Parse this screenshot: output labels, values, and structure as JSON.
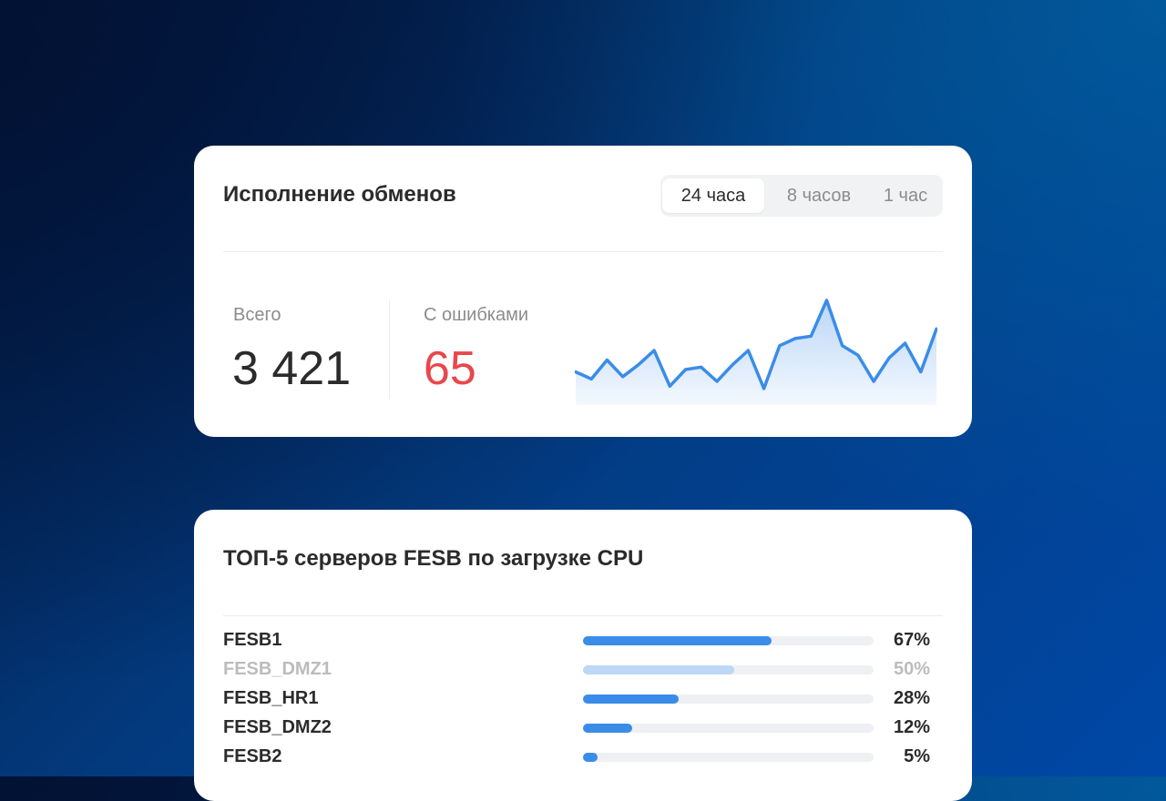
{
  "exchanges_card": {
    "title": "Исполнение обменов",
    "periods": [
      {
        "label": "24 часа",
        "active": true
      },
      {
        "label": "8 часов",
        "active": false
      },
      {
        "label": "1 час",
        "active": false
      }
    ],
    "total_label": "Всего",
    "total_value": "3 421",
    "errors_label": "С ошибками",
    "errors_value": "65",
    "errors_color": "#e8474b",
    "sparkline": [
      12,
      9,
      17,
      10,
      15,
      21,
      6,
      13,
      14,
      8,
      15,
      21,
      5,
      23,
      26,
      27,
      42,
      23,
      19,
      8,
      18,
      24,
      12,
      30
    ],
    "sparkline_color": "#3b8ce8"
  },
  "servers_card": {
    "title": "ТОП-5 серверов FESB по загрузке CPU",
    "rows": [
      {
        "name": "FESB1",
        "percent_label": "67%",
        "value": 0.65,
        "muted": false
      },
      {
        "name": "FESB_DMZ1",
        "percent_label": "50%",
        "value": 0.52,
        "muted": true
      },
      {
        "name": "FESB_HR1",
        "percent_label": "28%",
        "value": 0.33,
        "muted": false
      },
      {
        "name": "FESB_DMZ2",
        "percent_label": "12%",
        "value": 0.17,
        "muted": false
      },
      {
        "name": "FESB2",
        "percent_label": "5%",
        "value": 0.05,
        "muted": false
      }
    ]
  }
}
